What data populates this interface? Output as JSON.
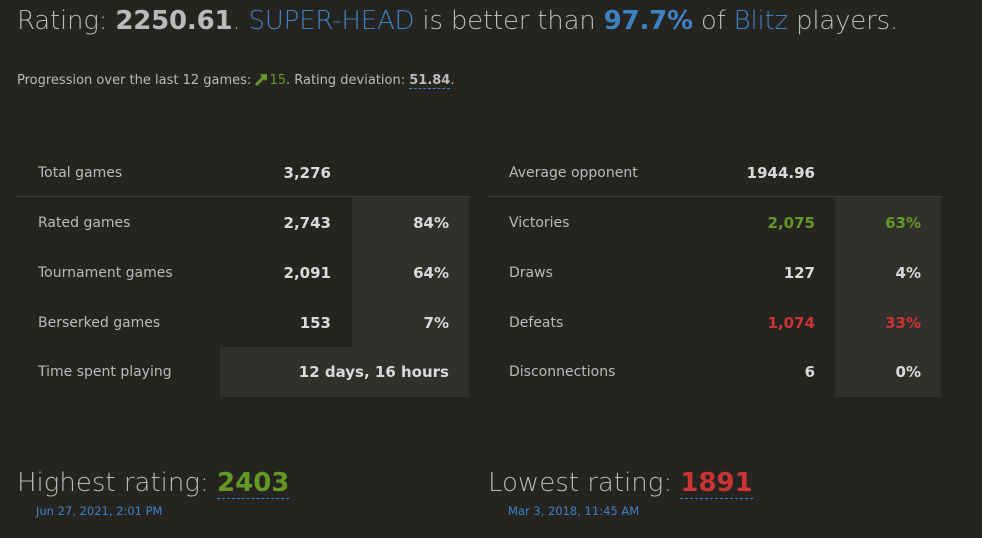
{
  "headline": {
    "prefix": "Rating: ",
    "rating": "2250.61",
    "sep": ". ",
    "username": "SUPER-HEAD",
    "middle": " is better than ",
    "percentile": "97.7%",
    "of": " of ",
    "variant": "Blitz",
    "suffix": " players."
  },
  "progression": {
    "label": "Progression over the last 12 games: ",
    "value": "15",
    "deviation_label": ". Rating deviation: ",
    "deviation": "51.84",
    "end": "."
  },
  "left_table": {
    "total": {
      "label": "Total games",
      "value": "3,276"
    },
    "rated": {
      "label": "Rated games",
      "value": "2,743",
      "pct": "84%"
    },
    "tournament": {
      "label": "Tournament games",
      "value": "2,091",
      "pct": "64%"
    },
    "berserked": {
      "label": "Berserked games",
      "value": "153",
      "pct": "7%"
    },
    "time": {
      "label": "Time spent playing",
      "value": "12 days, 16 hours"
    }
  },
  "right_table": {
    "avg": {
      "label": "Average opponent",
      "value": "1944.96"
    },
    "victories": {
      "label": "Victories",
      "value": "2,075",
      "pct": "63%"
    },
    "draws": {
      "label": "Draws",
      "value": "127",
      "pct": "4%"
    },
    "defeats": {
      "label": "Defeats",
      "value": "1,074",
      "pct": "33%"
    },
    "disconnections": {
      "label": "Disconnections",
      "value": "6",
      "pct": "0%"
    }
  },
  "highest": {
    "label": "Highest rating: ",
    "value": "2403",
    "date": "Jun 27, 2021, 2:01 PM"
  },
  "lowest": {
    "label": "Lowest rating: ",
    "value": "1891",
    "date": "Mar 3, 2018, 11:45 AM"
  },
  "colors": {
    "background": "#262421",
    "link": "#3d81c3",
    "good": "#629924",
    "bad": "#cc3333",
    "shade": "#32302d"
  }
}
